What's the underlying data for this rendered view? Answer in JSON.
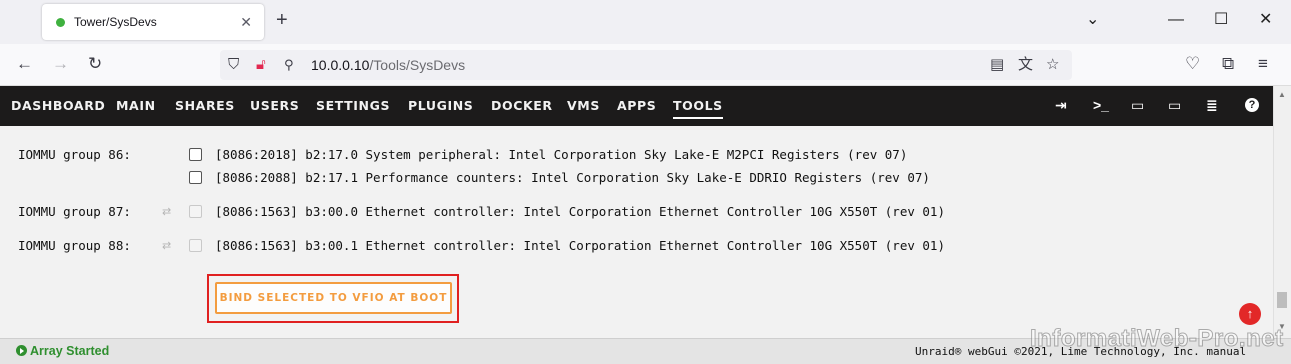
{
  "browser": {
    "tab_title": "Tower/SysDevs",
    "new_tab_icon": "+",
    "url_host": "10.0.0.10",
    "url_path": "/Tools/SysDevs"
  },
  "nav": {
    "items": [
      "DASHBOARD",
      "MAIN",
      "SHARES",
      "USERS",
      "SETTINGS",
      "PLUGINS",
      "DOCKER",
      "VMS",
      "APPS",
      "TOOLS"
    ],
    "active": "TOOLS"
  },
  "devices": [
    {
      "group": "IOMMU group 86:",
      "text": "[8086:2018] b2:17.0 System peripheral: Intel Corporation Sky Lake-E M2PCI Registers (rev 07)",
      "enabled": true,
      "reset_icon": false
    },
    {
      "group": "",
      "text": "[8086:2088] b2:17.1 Performance counters: Intel Corporation Sky Lake-E DDRIO Registers (rev 07)",
      "enabled": true,
      "reset_icon": false
    },
    {
      "group": "IOMMU group 87:",
      "text": "[8086:1563] b3:00.0 Ethernet controller: Intel Corporation Ethernet Controller 10G X550T (rev 01)",
      "enabled": false,
      "reset_icon": true
    },
    {
      "group": "IOMMU group 88:",
      "text": "[8086:1563] b3:00.1 Ethernet controller: Intel Corporation Ethernet Controller 10G X550T (rev 01)",
      "enabled": false,
      "reset_icon": true
    }
  ],
  "bind_button": "BIND SELECTED TO VFIO AT BOOT",
  "footer": {
    "status": "Array Started",
    "copyright": "Unraid® webGui ©2021, Lime Technology, Inc. manual"
  },
  "watermark": "InformatiWeb-Pro.net",
  "colors": {
    "header_bg": "#1c1b1b",
    "accent_orange": "#f39c3f",
    "status_green": "#2f8f2f",
    "highlight_red": "#e02020"
  }
}
